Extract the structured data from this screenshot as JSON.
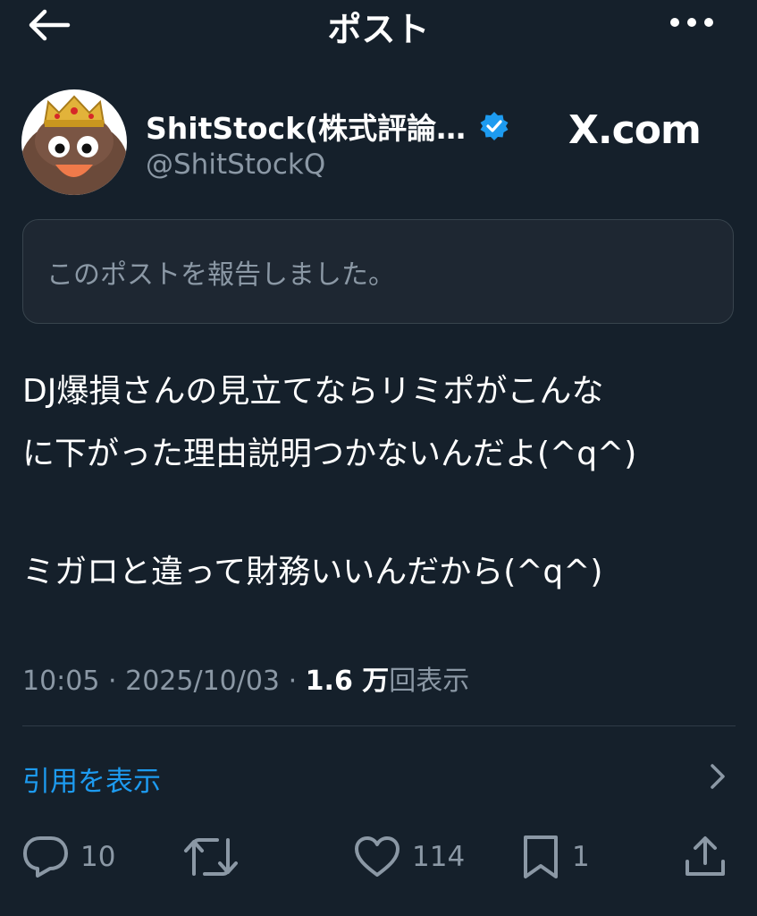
{
  "header": {
    "title": "ポスト"
  },
  "author": {
    "display_name": "ShitStock(株式評論…",
    "handle": "@ShitStockQ",
    "watermark": "X.com"
  },
  "notice": {
    "text": "このポストを報告しました。"
  },
  "post": {
    "lines": [
      "DJ爆損さんの見立てならリミポがこんな",
      "に下がった理由説明つかないんだよ(^q^)",
      "ミガロと違って財務いいんだから(^q^)"
    ],
    "time": "10:05",
    "date": "2025/10/03",
    "views_count": "1.6 万",
    "views_label": "回表示",
    "separator": "·"
  },
  "quotes": {
    "label": "引用を表示"
  },
  "actions": {
    "replies": "10",
    "likes": "114",
    "bookmarks": "1"
  },
  "colors": {
    "background": "#15202b",
    "accent": "#1d9bf0",
    "secondary_text": "#8b98a5"
  },
  "icons": [
    "back-arrow-icon",
    "more-icon",
    "verified-badge-icon",
    "chevron-right-icon",
    "reply-icon",
    "retweet-icon",
    "like-icon",
    "bookmark-icon",
    "share-icon"
  ]
}
